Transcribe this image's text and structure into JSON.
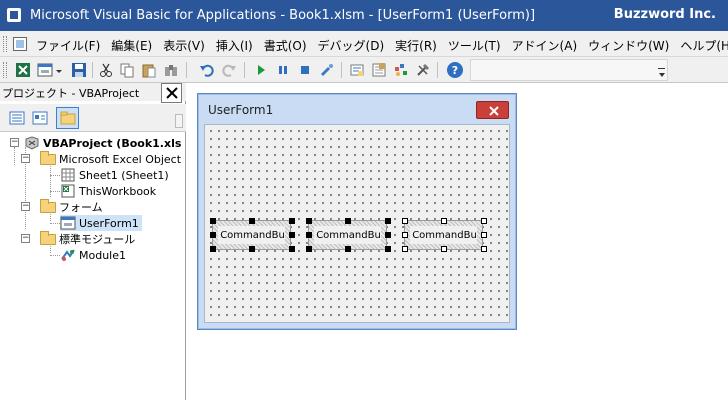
{
  "window": {
    "title": "Microsoft Visual Basic for Applications - Book1.xlsm - [UserForm1 (UserForm)]",
    "brand": "Buzzword Inc.",
    "title_bar_color": "#2b579a"
  },
  "menu": {
    "items": [
      "ファイル(F)",
      "編集(E)",
      "表示(V)",
      "挿入(I)",
      "書式(O)",
      "デバッグ(D)",
      "実行(R)",
      "ツール(T)",
      "アドイン(A)",
      "ウィンドウ(W)",
      "ヘルプ(H)"
    ]
  },
  "toolbar": {
    "icons": [
      "view-excel-icon",
      "insert-userform-icon",
      "save-icon",
      "cut-icon",
      "copy-icon",
      "paste-icon",
      "find-icon",
      "undo-icon",
      "redo-icon",
      "run-icon",
      "break-icon",
      "reset-icon",
      "design-mode-icon",
      "project-explorer-icon",
      "properties-icon",
      "object-browser-icon",
      "toolbox-icon",
      "help-icon"
    ]
  },
  "project_panel": {
    "title": "プロジェクト - VBAProject",
    "tree": {
      "root": "VBAProject (Book1.xls",
      "excel_objects_folder": "Microsoft Excel Object",
      "sheet1": "Sheet1 (Sheet1)",
      "this_workbook": "ThisWorkbook",
      "forms_folder": "フォーム",
      "userform1": "UserForm1",
      "modules_folder": "標準モジュール",
      "module1": "Module1"
    }
  },
  "designer": {
    "form_caption": "UserForm1",
    "buttons": [
      "CommandBu",
      "CommandBu",
      "CommandBu"
    ]
  }
}
